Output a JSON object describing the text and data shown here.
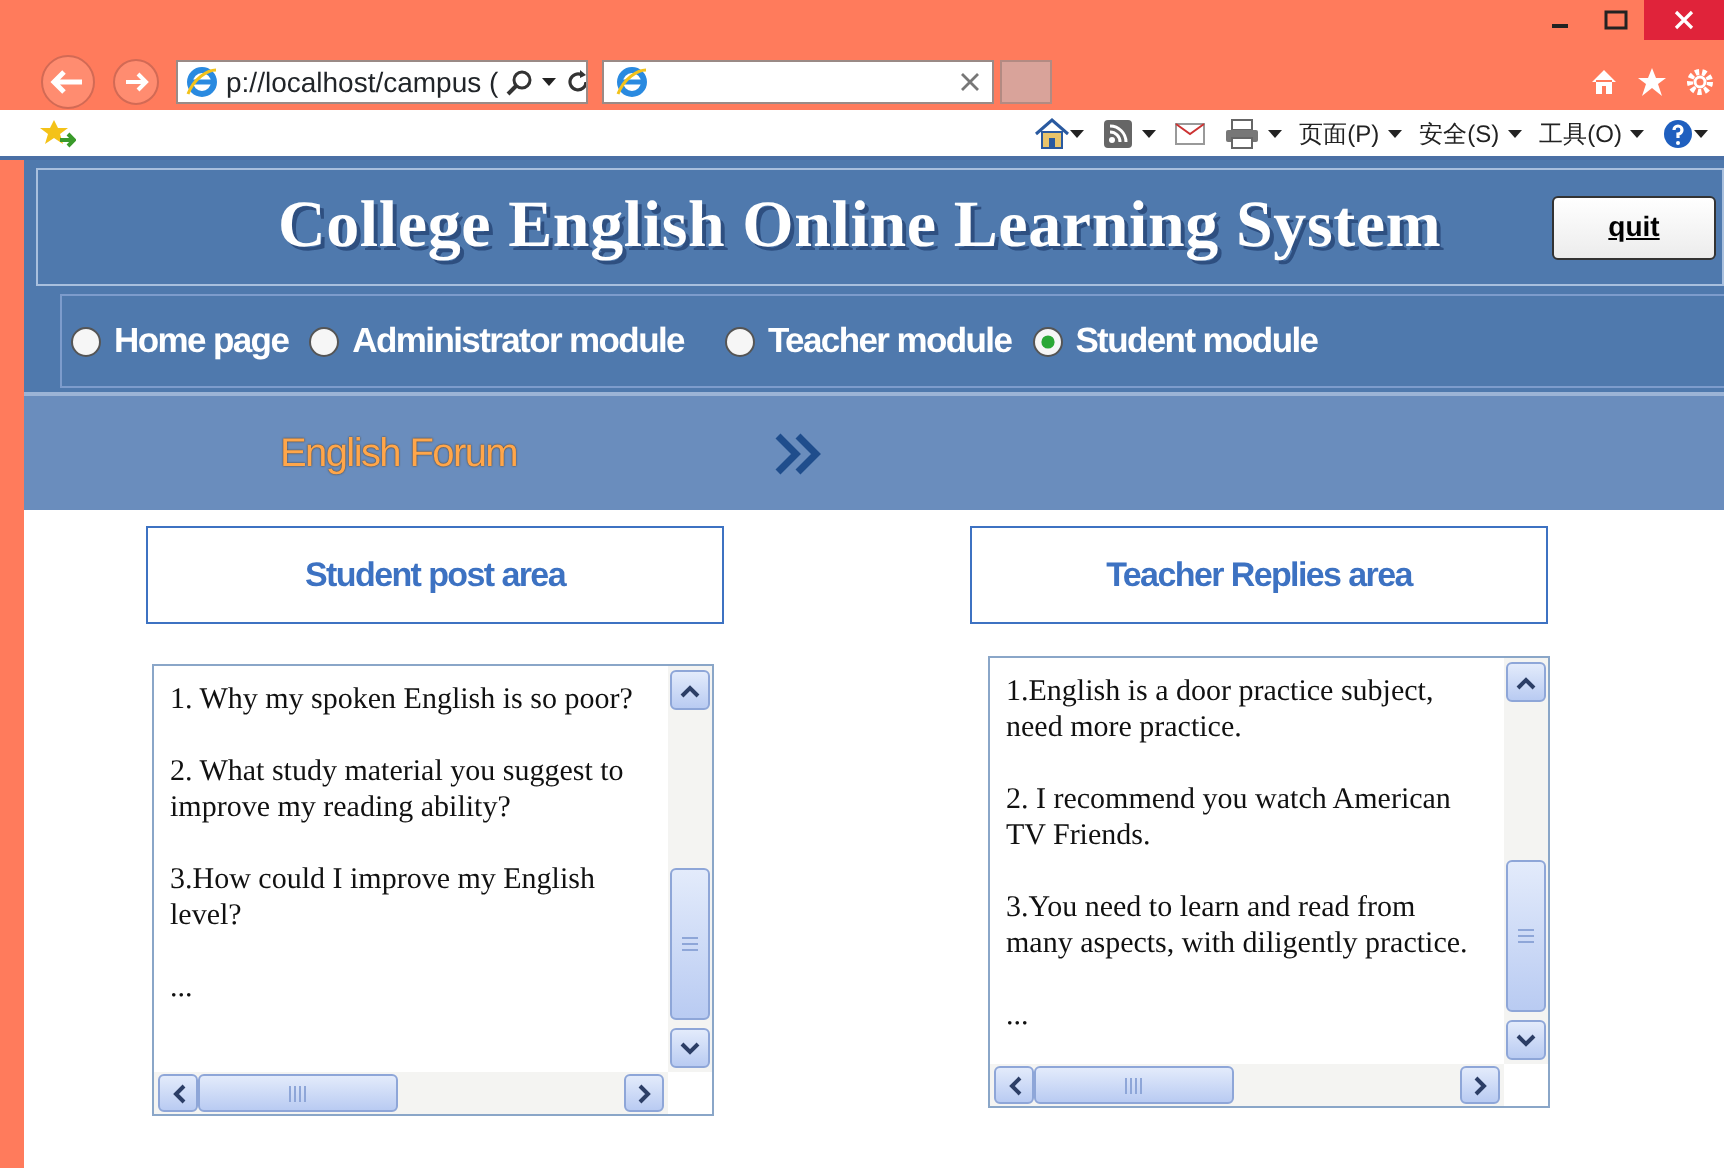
{
  "browser": {
    "address": "p://localhost/campus (",
    "command_menus": [
      "页面(P)",
      "安全(S)",
      "工具(O)"
    ]
  },
  "header": {
    "title": "College English Online Learning System",
    "quit_button": "quit"
  },
  "modules": [
    {
      "label": "Home page",
      "selected": false
    },
    {
      "label": "Administrator module",
      "selected": false
    },
    {
      "label": "Teacher module",
      "selected": false
    },
    {
      "label": "Student module",
      "selected": true
    }
  ],
  "forum_bar": {
    "title": "English Forum"
  },
  "panels": [
    {
      "title": "Student post area",
      "items": [
        "1. Why my spoken English is so poor?",
        "2. What study material you suggest to improve my reading ability?",
        "3.How could I improve my English level?",
        "..."
      ]
    },
    {
      "title": "Teacher Replies area",
      "items": [
        "1.English is a door practice subject, need more practice.",
        "2. I recommend you watch American TV Friends.",
        "3.You need to learn and read from many aspects, with diligently practice.",
        "..."
      ]
    }
  ]
}
